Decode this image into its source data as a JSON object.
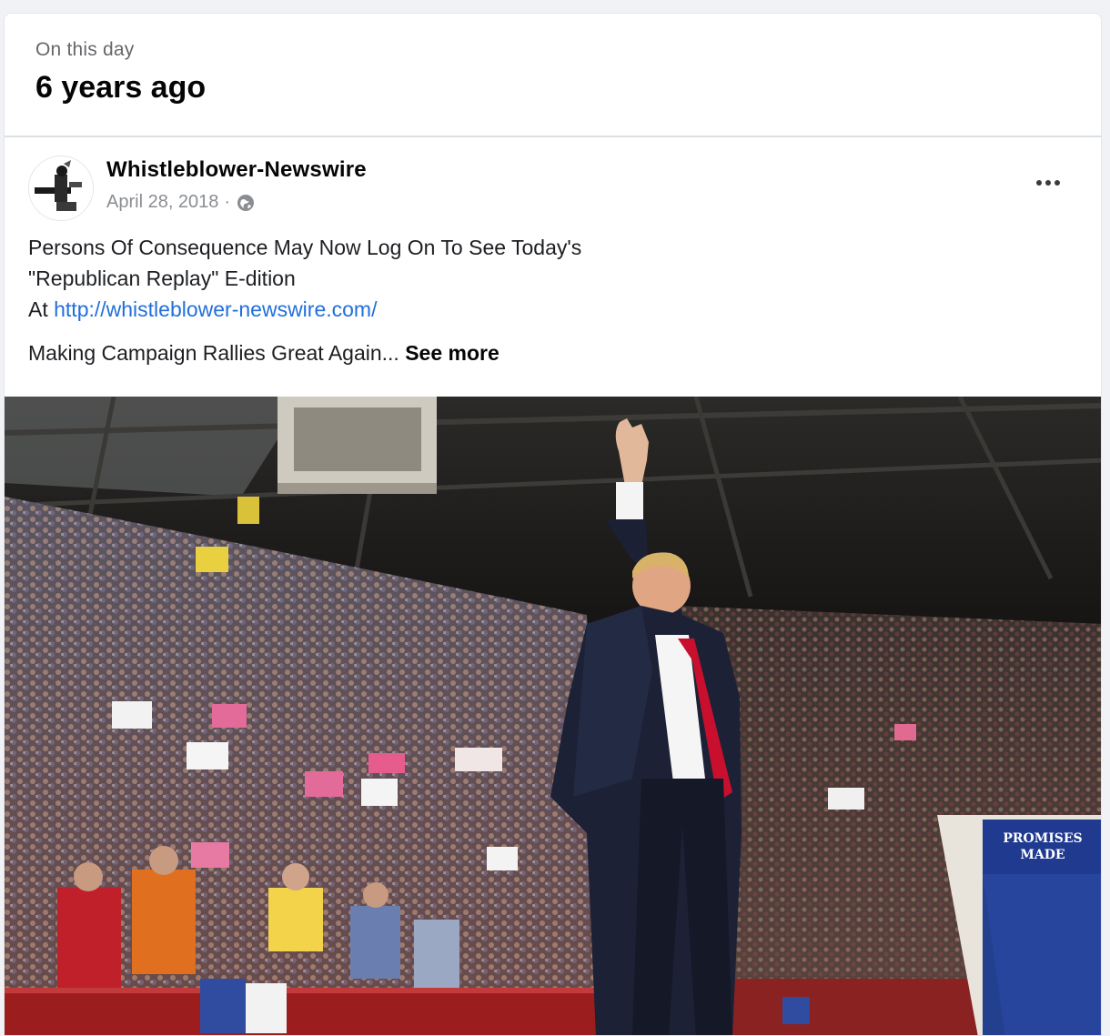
{
  "memory": {
    "kicker": "On this day",
    "title": "6 years ago"
  },
  "post": {
    "author": "Whistleblower-Newswire",
    "date": "April 28, 2018",
    "separator": "·",
    "privacy_icon": "globe-icon",
    "more_icon": "more-options-icon",
    "text": {
      "line1": "Persons Of Consequence May Now Log On To See Today's",
      "line2": "\"Republican Replay\" E-dition",
      "line3_prefix": "At ",
      "link": "http://whistleblower-newswire.com/",
      "line4": "Making Campaign Rallies Great Again...",
      "see_more": "See more"
    },
    "photo": {
      "sign_text": "PROMISES MADE"
    }
  },
  "colors": {
    "link": "#216fdb",
    "sign_blue": "#1f3a8f",
    "tie_red": "#c8102e"
  }
}
